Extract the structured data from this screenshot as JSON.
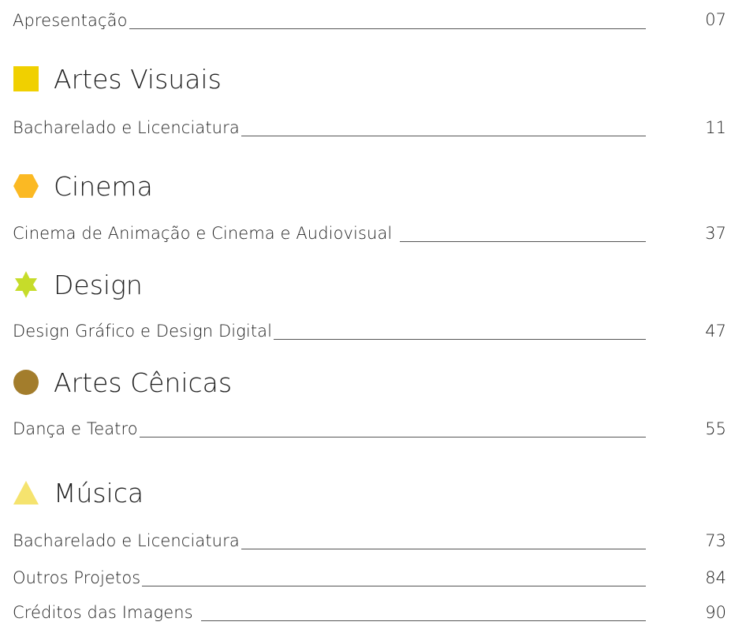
{
  "toc": {
    "apresentacao": {
      "label": "Apresentação",
      "page": "07"
    },
    "sections": [
      {
        "title": "Artes Visuais",
        "icon": "square-icon",
        "color": "#f0d000",
        "items": [
          {
            "label": "Bacharelado e Licenciatura",
            "page": "11"
          }
        ]
      },
      {
        "title": "Cinema",
        "icon": "hexagon-icon",
        "color": "#fbb923",
        "items": [
          {
            "label": "Cinema de Animação e Cinema e Audiovisual",
            "page": "37"
          }
        ]
      },
      {
        "title": "Design",
        "icon": "star-icon",
        "color": "#c6dc2a",
        "items": [
          {
            "label": "Design Gráfico e Design Digital",
            "page": "47"
          }
        ]
      },
      {
        "title": "Artes Cênicas",
        "icon": "circle-icon",
        "color": "#a37d2c",
        "items": [
          {
            "label": "Dança e Teatro",
            "page": "55"
          }
        ]
      },
      {
        "title": "Música",
        "icon": "triangle-icon",
        "color": "#f5e36e",
        "items": [
          {
            "label": "Bacharelado e Licenciatura",
            "page": "73"
          },
          {
            "label": "Outros Projetos",
            "page": "84"
          }
        ]
      }
    ],
    "creditos": {
      "label": "Créditos das Imagens",
      "page": "90"
    }
  }
}
